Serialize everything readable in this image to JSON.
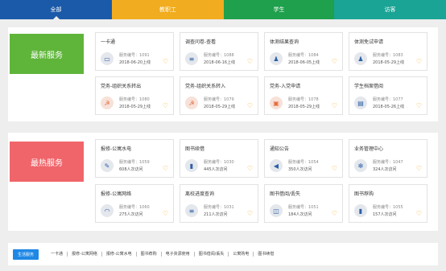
{
  "tabs": [
    {
      "label": "全部"
    },
    {
      "label": "教职工"
    },
    {
      "label": "学生"
    },
    {
      "label": "访客"
    }
  ],
  "sections": [
    {
      "label": "最新服务",
      "cards": [
        {
          "title": "一卡通",
          "icon": "card-icon",
          "line1": "服务编号：1091",
          "line2": "2018-06-20上线"
        },
        {
          "title": "调查问卷-查看",
          "icon": "list-icon",
          "line1": "服务编号：1088",
          "line2": "2018-06-16上线"
        },
        {
          "title": "体测结果查询",
          "icon": "person-icon",
          "line1": "服务编号：1084",
          "line2": "2018-06-05上线"
        },
        {
          "title": "体测免试申请",
          "icon": "person-icon",
          "line1": "服务编号：1083",
          "line2": "2018-05-29上线"
        },
        {
          "title": "党务-组织关系转出",
          "icon": "party-icon",
          "line1": "服务编号：1080",
          "line2": "2018-05-29上线"
        },
        {
          "title": "党务-组织关系转入",
          "icon": "party-icon",
          "line1": "服务编号：1079",
          "line2": "2018-05-29上线"
        },
        {
          "title": "党务-入党申请",
          "icon": "party-doc-icon",
          "line1": "服务编号：1078",
          "line2": "2018-05-29上线"
        },
        {
          "title": "学生档案借阅",
          "icon": "id-card-icon",
          "line1": "服务编号：1077",
          "line2": "2018-05-26上线"
        }
      ]
    },
    {
      "label": "最热服务",
      "cards": [
        {
          "title": "报修-公寓水电",
          "icon": "wrench-icon",
          "line1": "服务编号：1059",
          "line2": "608人次访问"
        },
        {
          "title": "图书续借",
          "icon": "book-icon",
          "line1": "服务编号：1030",
          "line2": "445人次访问"
        },
        {
          "title": "通知公告",
          "icon": "megaphone-icon",
          "line1": "服务编号：1054",
          "line2": "350人次访问"
        },
        {
          "title": "业务管理中心",
          "icon": "gear-icon",
          "line1": "服务编号：1047",
          "line2": "324人次访问"
        },
        {
          "title": "报修-公寓网络",
          "icon": "wifi-icon",
          "line1": "服务编号：1060",
          "line2": "275人次访问"
        },
        {
          "title": "离校进度查询",
          "icon": "list-icon",
          "line1": "服务编号：1031",
          "line2": "211人次访问"
        },
        {
          "title": "图书借阅/丢失",
          "icon": "open-book-icon",
          "line1": "服务编号：1051",
          "line2": "184人次访问"
        },
        {
          "title": "图书荐购",
          "icon": "book-icon",
          "line1": "服务编号：1055",
          "line2": "157人次访问"
        }
      ]
    }
  ],
  "footer": {
    "badge": "生活服务",
    "links": [
      "一卡通",
      "报修-公寓网络",
      "报修-公寓水电",
      "图书荐购",
      "电子资源使用",
      "图书借阅/丢失",
      "公寓购电",
      "图书续借"
    ]
  },
  "colors": {
    "tab_all": "#1b5aa8",
    "tab_staff": "#f1ac1f",
    "tab_student": "#1ea04c",
    "tab_visitor": "#1aa495",
    "newest_label": "#5fb53a",
    "hottest_label": "#f0656a",
    "heart": "#f1ac1f",
    "footer_badge": "#1e88e5"
  }
}
